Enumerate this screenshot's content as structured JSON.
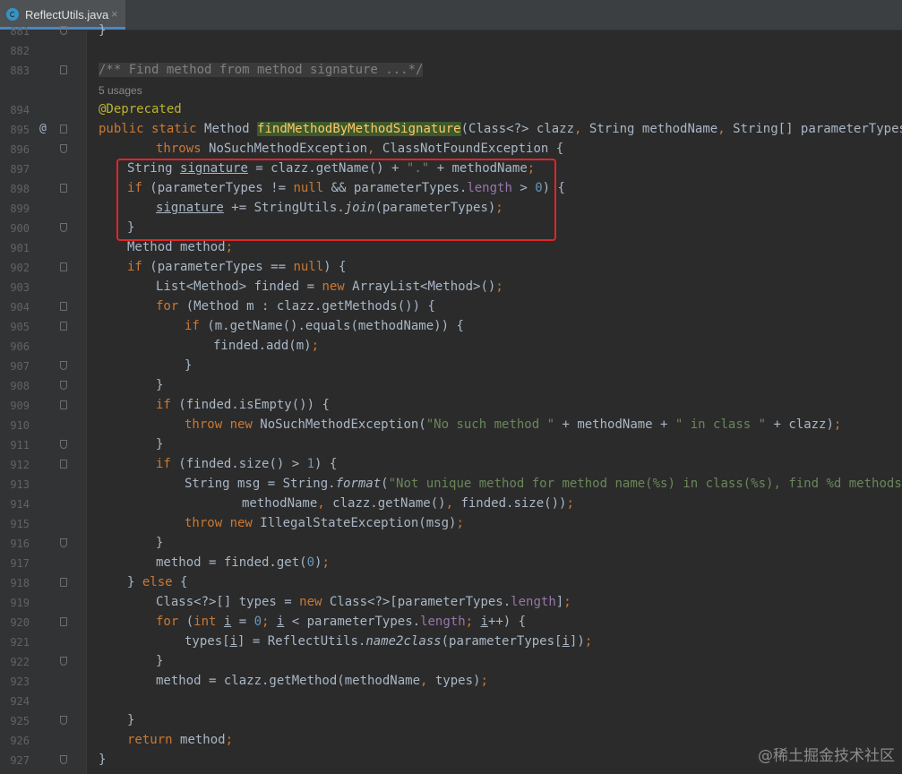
{
  "tab": {
    "label": "ReflectUtils.java",
    "close": "×",
    "icon": "java-class-icon"
  },
  "watermark": "@稀土掘金技术社区",
  "usages": "5 usages",
  "lines": [
    {
      "n": "881",
      "indent": 0,
      "fold": "end",
      "segs": [
        [
          "}",
          ""
        ]
      ]
    },
    {
      "n": "882",
      "indent": 0,
      "fold": "",
      "segs": []
    },
    {
      "n": "883",
      "indent": 0,
      "fold": "start",
      "segs": [
        [
          "/** Find method from method signature ...*/",
          "cmt fold-bg"
        ]
      ]
    },
    {
      "n": "",
      "indent": 0,
      "fold": "",
      "usages": true,
      "segs": []
    },
    {
      "n": "894",
      "indent": 0,
      "fold": "",
      "segs": [
        [
          "@Deprecated",
          "anno"
        ]
      ]
    },
    {
      "n": "895",
      "indent": 0,
      "fold": "start",
      "ann": "@",
      "segs": [
        [
          "public static ",
          "kw"
        ],
        [
          "Method ",
          ""
        ],
        [
          "findMethodByMethodSignature",
          "mhl"
        ],
        [
          "(Class<?> clazz",
          ""
        ],
        [
          ", ",
          "kw"
        ],
        [
          "String methodName",
          ""
        ],
        [
          ", ",
          "kw"
        ],
        [
          "String[] parameterTypes)",
          ""
        ]
      ]
    },
    {
      "n": "896",
      "indent": 2,
      "fold": "end",
      "segs": [
        [
          "throws ",
          "kw"
        ],
        [
          "NoSuchMethodException",
          ""
        ],
        [
          ", ",
          "kw"
        ],
        [
          "ClassNotFoundException {",
          ""
        ]
      ]
    },
    {
      "n": "897",
      "indent": 1,
      "fold": "",
      "segs": [
        [
          "String ",
          ""
        ],
        [
          "signature",
          "ul"
        ],
        [
          " = clazz.getName() + ",
          ""
        ],
        [
          "\".\"",
          "str"
        ],
        [
          " + methodName",
          ""
        ],
        [
          ";",
          "kw"
        ]
      ]
    },
    {
      "n": "898",
      "indent": 1,
      "fold": "start",
      "segs": [
        [
          "if ",
          "kw"
        ],
        [
          "(parameterTypes != ",
          ""
        ],
        [
          "null ",
          "kw"
        ],
        [
          "&& parameterTypes.",
          ""
        ],
        [
          "length",
          "fld"
        ],
        [
          " > ",
          ""
        ],
        [
          "0",
          "num"
        ],
        [
          ") {",
          ""
        ]
      ]
    },
    {
      "n": "899",
      "indent": 2,
      "fold": "",
      "segs": [
        [
          "signature",
          "ul"
        ],
        [
          " += StringUtils.",
          ""
        ],
        [
          "join",
          "ital"
        ],
        [
          "(parameterTypes)",
          ""
        ],
        [
          ";",
          "kw"
        ]
      ]
    },
    {
      "n": "900",
      "indent": 1,
      "fold": "end",
      "segs": [
        [
          "}",
          ""
        ]
      ]
    },
    {
      "n": "901",
      "indent": 1,
      "fold": "",
      "segs": [
        [
          "Method method",
          ""
        ],
        [
          ";",
          "kw"
        ]
      ]
    },
    {
      "n": "902",
      "indent": 1,
      "fold": "start",
      "segs": [
        [
          "if ",
          "kw"
        ],
        [
          "(parameterTypes == ",
          ""
        ],
        [
          "null",
          "kw"
        ],
        [
          ") {",
          ""
        ]
      ]
    },
    {
      "n": "903",
      "indent": 2,
      "fold": "",
      "segs": [
        [
          "List<Method> finded = ",
          ""
        ],
        [
          "new ",
          "kw"
        ],
        [
          "ArrayList<Method>()",
          ""
        ],
        [
          ";",
          "kw"
        ]
      ]
    },
    {
      "n": "904",
      "indent": 2,
      "fold": "start",
      "segs": [
        [
          "for ",
          "kw"
        ],
        [
          "(Method m : clazz.getMethods()) {",
          ""
        ]
      ]
    },
    {
      "n": "905",
      "indent": 3,
      "fold": "start",
      "segs": [
        [
          "if ",
          "kw"
        ],
        [
          "(m.getName().equals(methodName)) {",
          ""
        ]
      ]
    },
    {
      "n": "906",
      "indent": 4,
      "fold": "",
      "segs": [
        [
          "finded.add(m)",
          ""
        ],
        [
          ";",
          "kw"
        ]
      ]
    },
    {
      "n": "907",
      "indent": 3,
      "fold": "end",
      "segs": [
        [
          "}",
          ""
        ]
      ]
    },
    {
      "n": "908",
      "indent": 2,
      "fold": "end",
      "segs": [
        [
          "}",
          ""
        ]
      ]
    },
    {
      "n": "909",
      "indent": 2,
      "fold": "start",
      "segs": [
        [
          "if ",
          "kw"
        ],
        [
          "(finded.isEmpty()) {",
          ""
        ]
      ]
    },
    {
      "n": "910",
      "indent": 3,
      "fold": "",
      "segs": [
        [
          "throw new ",
          "kw"
        ],
        [
          "NoSuchMethodException(",
          ""
        ],
        [
          "\"No such method \"",
          "str"
        ],
        [
          " + methodName + ",
          ""
        ],
        [
          "\" in class \"",
          "str"
        ],
        [
          " + clazz)",
          ""
        ],
        [
          ";",
          "kw"
        ]
      ]
    },
    {
      "n": "911",
      "indent": 2,
      "fold": "end",
      "segs": [
        [
          "}",
          ""
        ]
      ]
    },
    {
      "n": "912",
      "indent": 2,
      "fold": "start",
      "segs": [
        [
          "if ",
          "kw"
        ],
        [
          "(finded.size() > ",
          ""
        ],
        [
          "1",
          "num"
        ],
        [
          ") {",
          ""
        ]
      ]
    },
    {
      "n": "913",
      "indent": 3,
      "fold": "",
      "segs": [
        [
          "String msg = String.",
          ""
        ],
        [
          "format",
          "ital"
        ],
        [
          "(",
          ""
        ],
        [
          "\"Not unique method for method name(%s) in class(%s), find %d methods.\"",
          "str"
        ],
        [
          ",",
          "kw"
        ]
      ]
    },
    {
      "n": "914",
      "indent": 5,
      "fold": "",
      "segs": [
        [
          "methodName",
          ""
        ],
        [
          ", ",
          "kw"
        ],
        [
          "clazz.getName()",
          ""
        ],
        [
          ", ",
          "kw"
        ],
        [
          "finded.size())",
          ""
        ],
        [
          ";",
          "kw"
        ]
      ]
    },
    {
      "n": "915",
      "indent": 3,
      "fold": "",
      "segs": [
        [
          "throw new ",
          "kw"
        ],
        [
          "IllegalStateException(msg)",
          ""
        ],
        [
          ";",
          "kw"
        ]
      ]
    },
    {
      "n": "916",
      "indent": 2,
      "fold": "end",
      "segs": [
        [
          "}",
          ""
        ]
      ]
    },
    {
      "n": "917",
      "indent": 2,
      "fold": "",
      "segs": [
        [
          "method = finded.get(",
          ""
        ],
        [
          "0",
          "num"
        ],
        [
          ")",
          ""
        ],
        [
          ";",
          "kw"
        ]
      ]
    },
    {
      "n": "918",
      "indent": 1,
      "fold": "start",
      "segs": [
        [
          "} ",
          ""
        ],
        [
          "else ",
          "kw"
        ],
        [
          "{",
          ""
        ]
      ]
    },
    {
      "n": "919",
      "indent": 2,
      "fold": "",
      "segs": [
        [
          "Class<?>[] types = ",
          ""
        ],
        [
          "new ",
          "kw"
        ],
        [
          "Class<?>[parameterTypes.",
          ""
        ],
        [
          "length",
          "fld"
        ],
        [
          "]",
          ""
        ],
        [
          ";",
          "kw"
        ]
      ]
    },
    {
      "n": "920",
      "indent": 2,
      "fold": "start",
      "segs": [
        [
          "for ",
          "kw"
        ],
        [
          "(",
          ""
        ],
        [
          "int ",
          "kw"
        ],
        [
          "i",
          "ul"
        ],
        [
          " = ",
          ""
        ],
        [
          "0",
          "num"
        ],
        [
          "; ",
          "kw"
        ],
        [
          "i",
          "ul"
        ],
        [
          " < parameterTypes.",
          ""
        ],
        [
          "length",
          "fld"
        ],
        [
          "; ",
          "kw"
        ],
        [
          "i",
          "ul"
        ],
        [
          "++) {",
          ""
        ]
      ]
    },
    {
      "n": "921",
      "indent": 3,
      "fold": "",
      "segs": [
        [
          "types[",
          ""
        ],
        [
          "i",
          "ul"
        ],
        [
          "] = ReflectUtils.",
          ""
        ],
        [
          "name2class",
          "ital"
        ],
        [
          "(parameterTypes[",
          ""
        ],
        [
          "i",
          "ul"
        ],
        [
          "])",
          ""
        ],
        [
          ";",
          "kw"
        ]
      ]
    },
    {
      "n": "922",
      "indent": 2,
      "fold": "end",
      "segs": [
        [
          "}",
          ""
        ]
      ]
    },
    {
      "n": "923",
      "indent": 2,
      "fold": "",
      "segs": [
        [
          "method = clazz.getMethod(methodName",
          ""
        ],
        [
          ", ",
          "kw"
        ],
        [
          "types)",
          ""
        ],
        [
          ";",
          "kw"
        ]
      ]
    },
    {
      "n": "924",
      "indent": 0,
      "fold": "",
      "segs": []
    },
    {
      "n": "925",
      "indent": 1,
      "fold": "end",
      "segs": [
        [
          "}",
          ""
        ]
      ]
    },
    {
      "n": "926",
      "indent": 1,
      "fold": "",
      "segs": [
        [
          "return ",
          "kw"
        ],
        [
          "method",
          ""
        ],
        [
          ";",
          "kw"
        ]
      ]
    },
    {
      "n": "927",
      "indent": 0,
      "fold": "end",
      "segs": [
        [
          "}",
          ""
        ]
      ]
    }
  ]
}
